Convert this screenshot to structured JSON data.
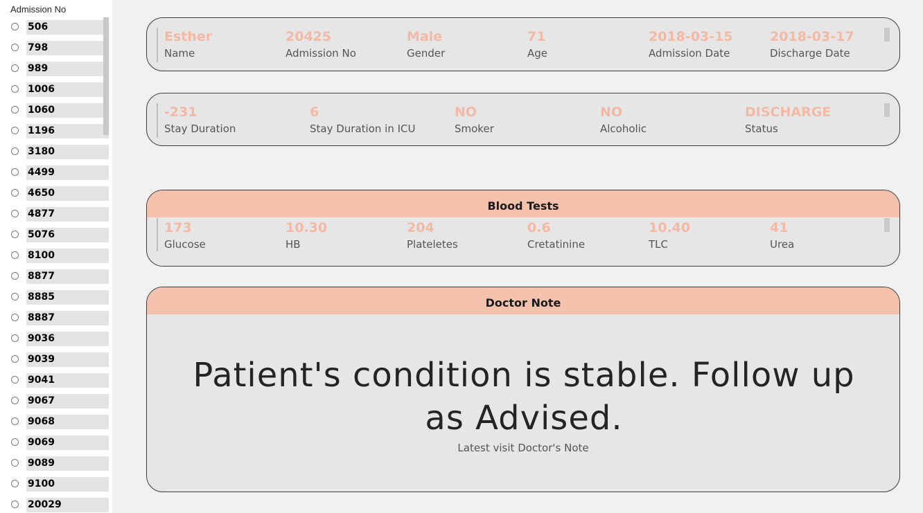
{
  "slicer": {
    "title": "Admission No",
    "items": [
      "506",
      "798",
      "989",
      "1006",
      "1060",
      "1196",
      "3180",
      "4499",
      "4650",
      "4877",
      "5076",
      "8100",
      "8877",
      "8885",
      "8887",
      "9036",
      "9039",
      "9041",
      "9067",
      "9068",
      "9069",
      "9089",
      "9100",
      "20029"
    ]
  },
  "patient": {
    "name": {
      "value": "Esther",
      "label": "Name"
    },
    "admission_no": {
      "value": "20425",
      "label": "Admission No"
    },
    "gender": {
      "value": "Male",
      "label": "Gender"
    },
    "age": {
      "value": "71",
      "label": "Age"
    },
    "admission_date": {
      "value": "2018-03-15",
      "label": "Admission Date"
    },
    "discharge_date": {
      "value": "2018-03-17",
      "label": "Discharge Date"
    }
  },
  "stay": {
    "stay_duration": {
      "value": "-231",
      "label": "Stay Duration"
    },
    "icu_duration": {
      "value": "6",
      "label": "Stay Duration in ICU"
    },
    "smoker": {
      "value": "NO",
      "label": "Smoker"
    },
    "alcoholic": {
      "value": "NO",
      "label": "Alcoholic"
    },
    "status": {
      "value": "DISCHARGE",
      "label": "Status"
    }
  },
  "blood_tests": {
    "title": "Blood Tests",
    "glucose": {
      "value": "173",
      "label": "Glucose"
    },
    "hb": {
      "value": "10.30",
      "label": "HB"
    },
    "platelets": {
      "value": "204",
      "label": "Plateletes"
    },
    "creatinine": {
      "value": "0.6",
      "label": "Cretatinine"
    },
    "tlc": {
      "value": "10.40",
      "label": "TLC"
    },
    "urea": {
      "value": "41",
      "label": "Urea"
    }
  },
  "doctor_note": {
    "title": "Doctor Note",
    "text": "Patient's condition is stable. Follow up as Advised.",
    "caption": "Latest visit Doctor's Note"
  },
  "colors": {
    "accent_value": "#f4b9a5",
    "header_fill": "#f4c1ad",
    "card_fill": "#e6e6e6"
  }
}
